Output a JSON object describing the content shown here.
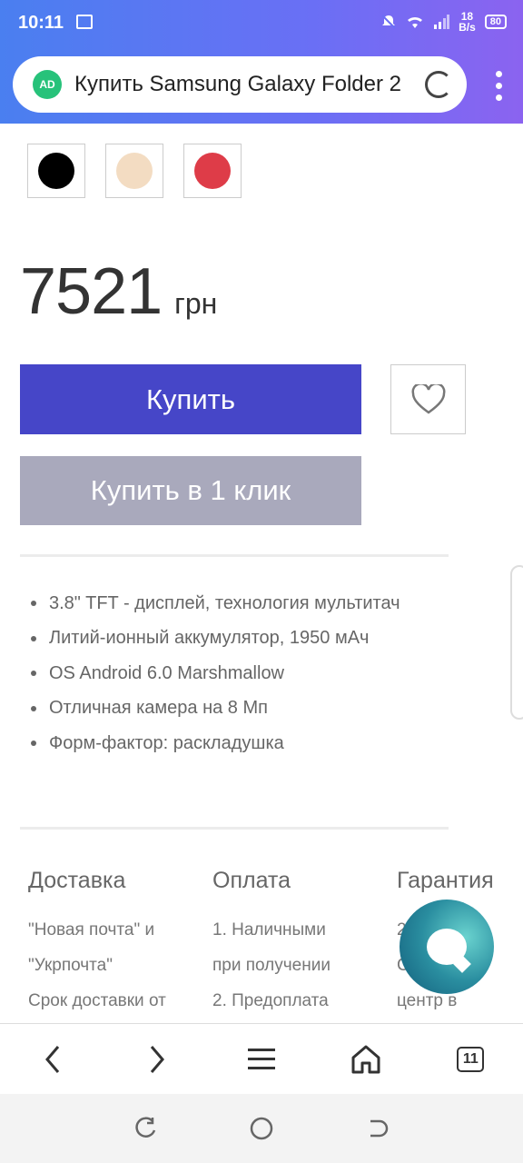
{
  "status": {
    "time": "10:11",
    "net_speed_value": "18",
    "net_speed_unit": "B/s",
    "battery": "80"
  },
  "url_bar": {
    "ad_badge": "AD",
    "title": "Купить Samsung Galaxy Folder 2"
  },
  "product": {
    "colors": [
      {
        "name": "black",
        "hex": "#000000"
      },
      {
        "name": "beige",
        "hex": "#f3dcc2"
      },
      {
        "name": "red",
        "hex": "#de3c48"
      }
    ],
    "price_value": "7521",
    "price_currency": "грн",
    "buy_label": "Купить",
    "one_click_label": "Купить в 1 клик",
    "features": [
      "3.8\" TFT - дисплей, технология мультитач",
      "Литий-ионный аккумулятор, 1950 мАч",
      "OS Android 6.0 Marshmallow",
      "Отличная камера на 8 Мп",
      "Форм-фактор: раскладушка"
    ]
  },
  "info": {
    "delivery": {
      "title": "Доставка",
      "lines": [
        "\"Новая почта\" и",
        "\"Укрпочта\"",
        "Срок доставки от"
      ]
    },
    "payment": {
      "title": "Оплата",
      "lines": [
        "1. Наличными",
        "при получении",
        "2. Предоплата"
      ]
    },
    "warranty": {
      "title": "Гарантия",
      "lines": [
        "2",
        "С                й",
        "центр в"
      ]
    }
  },
  "browser_nav": {
    "tab_count": "11"
  },
  "colors": {
    "accent": "#4646c8",
    "secondary_button": "#a9a9bc",
    "header_gradient_start": "#4a7ff0",
    "header_gradient_end": "#8b63f0"
  }
}
